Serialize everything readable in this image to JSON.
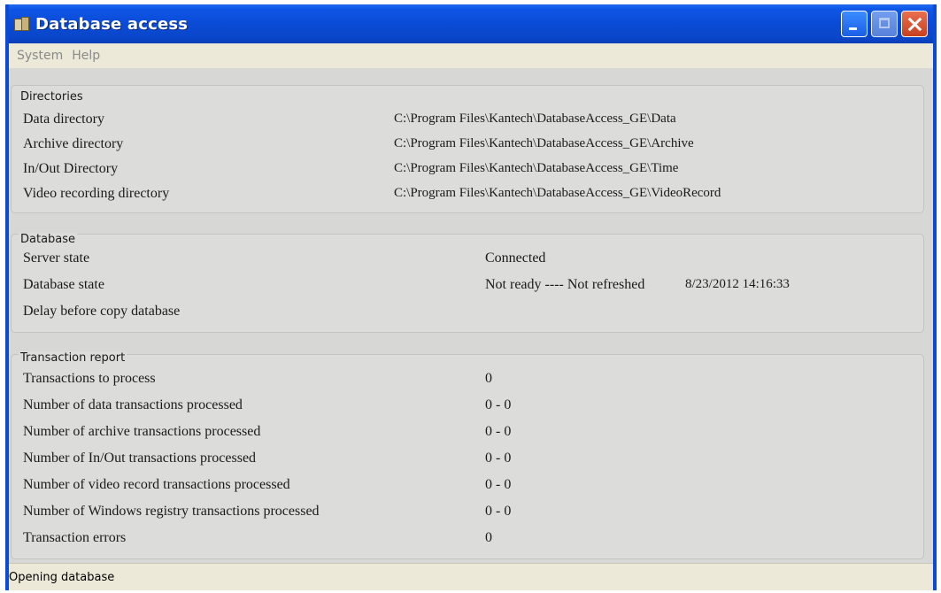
{
  "window": {
    "title": "Database access"
  },
  "menu": {
    "items": [
      "System",
      "Help"
    ]
  },
  "directories": {
    "label": "Directories",
    "rows": [
      {
        "label": "Data directory",
        "value": "C:\\Program Files\\Kantech\\DatabaseAccess_GE\\Data"
      },
      {
        "label": "Archive directory",
        "value": "C:\\Program Files\\Kantech\\DatabaseAccess_GE\\Archive"
      },
      {
        "label": "In/Out Directory",
        "value": "C:\\Program Files\\Kantech\\DatabaseAccess_GE\\Time"
      },
      {
        "label": "Video recording directory",
        "value": "C:\\Program Files\\Kantech\\DatabaseAccess_GE\\VideoRecord"
      }
    ]
  },
  "database": {
    "label": "Database",
    "rows": [
      {
        "label": "Server state",
        "value": "Connected",
        "extra": ""
      },
      {
        "label": "Database state",
        "value": "Not ready ---- Not refreshed",
        "extra": "8/23/2012 14:16:33"
      },
      {
        "label": "Delay before copy database",
        "value": "",
        "extra": ""
      }
    ]
  },
  "transactions": {
    "label": "Transaction report",
    "rows": [
      {
        "label": "Transactions to process",
        "value": "0"
      },
      {
        "label": "Number of data transactions processed",
        "value": "0 - 0"
      },
      {
        "label": "Number of archive transactions processed",
        "value": "0 - 0"
      },
      {
        "label": "Number of In/Out transactions processed",
        "value": "0 - 0"
      },
      {
        "label": "Number of video record transactions processed",
        "value": "0 - 0"
      },
      {
        "label": "Number of Windows registry transactions processed",
        "value": "0 - 0"
      },
      {
        "label": "Transaction errors",
        "value": "0"
      }
    ]
  },
  "status": {
    "text": "Opening database"
  },
  "colors": {
    "titlebar": "#0a4bd6",
    "close_button": "#c8401e",
    "panel_background": "#d7d7d5"
  }
}
